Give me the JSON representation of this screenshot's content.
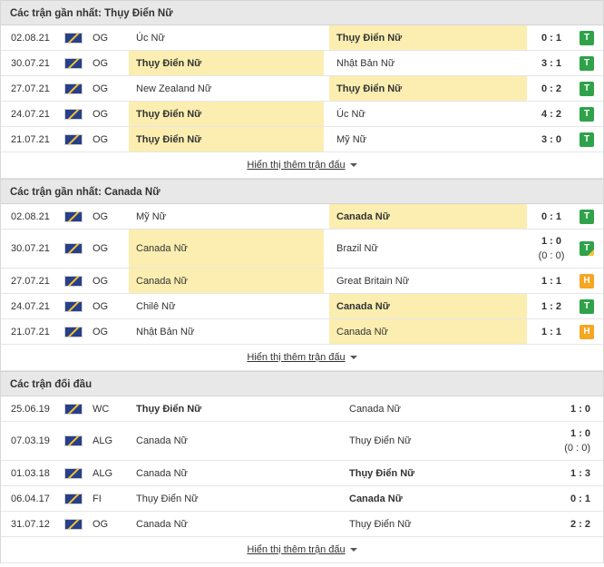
{
  "sections": [
    {
      "title": "Các trận gần nhất: Thụy Điển Nữ",
      "more_label": "Hiển thị thêm trận đấu",
      "matches": [
        {
          "date": "02.08.21",
          "comp": "OG",
          "home": "Úc Nữ",
          "away": "Thụy Điển Nữ",
          "highlight": "away",
          "score": "0 : 1",
          "sub": "",
          "result": "T",
          "result_color": "#2fa24a"
        },
        {
          "date": "30.07.21",
          "comp": "OG",
          "home": "Thụy Điển Nữ",
          "away": "Nhật Bản Nữ",
          "highlight": "home",
          "score": "3 : 1",
          "sub": "",
          "result": "T",
          "result_color": "#2fa24a"
        },
        {
          "date": "27.07.21",
          "comp": "OG",
          "home": "New Zealand Nữ",
          "away": "Thụy Điển Nữ",
          "highlight": "away",
          "score": "0 : 2",
          "sub": "",
          "result": "T",
          "result_color": "#2fa24a"
        },
        {
          "date": "24.07.21",
          "comp": "OG",
          "home": "Thụy Điển Nữ",
          "away": "Úc Nữ",
          "highlight": "home",
          "score": "4 : 2",
          "sub": "",
          "result": "T",
          "result_color": "#2fa24a"
        },
        {
          "date": "21.07.21",
          "comp": "OG",
          "home": "Thụy Điển Nữ",
          "away": "Mỹ Nữ",
          "highlight": "home",
          "score": "3 : 0",
          "sub": "",
          "result": "T",
          "result_color": "#2fa24a"
        }
      ]
    },
    {
      "title": "Các trận gần nhất: Canada Nữ",
      "more_label": "Hiển thị thêm trận đấu",
      "matches": [
        {
          "date": "02.08.21",
          "comp": "OG",
          "home": "Mỹ Nữ",
          "away": "Canada Nữ",
          "highlight": "away",
          "score": "0 : 1",
          "sub": "",
          "result": "T",
          "result_color": "#2fa24a"
        },
        {
          "date": "30.07.21",
          "comp": "OG",
          "home": "Canada Nữ",
          "away": "Brazil Nữ",
          "highlight": "home-light",
          "score": "1 : 0",
          "sub": "(0 : 0)",
          "result": "T",
          "result_color": "#2fa24a",
          "corner": true
        },
        {
          "date": "27.07.21",
          "comp": "OG",
          "home": "Canada Nữ",
          "away": "Great Britain Nữ",
          "highlight": "home-light",
          "score": "1 : 1",
          "sub": "",
          "result": "H",
          "result_color": "#f5a623"
        },
        {
          "date": "24.07.21",
          "comp": "OG",
          "home": "Chilê Nữ",
          "away": "Canada Nữ",
          "highlight": "away",
          "score": "1 : 2",
          "sub": "",
          "result": "T",
          "result_color": "#2fa24a"
        },
        {
          "date": "21.07.21",
          "comp": "OG",
          "home": "Nhật Bản Nữ",
          "away": "Canada Nữ",
          "highlight": "away-light",
          "score": "1 : 1",
          "sub": "",
          "result": "H",
          "result_color": "#f5a623"
        }
      ]
    }
  ],
  "h2h": {
    "title": "Các trận đối đầu",
    "more_label": "Hiển thị thêm trận đấu",
    "matches": [
      {
        "date": "25.06.19",
        "comp": "WC",
        "home": "Thụy Điển Nữ",
        "away": "Canada Nữ",
        "bold": "home",
        "score": "1 : 0",
        "sub": ""
      },
      {
        "date": "07.03.19",
        "comp": "ALG",
        "home": "Canada Nữ",
        "away": "Thụy Điển Nữ",
        "bold": "",
        "score": "1 : 0",
        "sub": "(0 : 0)"
      },
      {
        "date": "01.03.18",
        "comp": "ALG",
        "home": "Canada Nữ",
        "away": "Thụy Điển Nữ",
        "bold": "away",
        "score": "1 : 3",
        "sub": ""
      },
      {
        "date": "06.04.17",
        "comp": "FI",
        "home": "Thụy Điển Nữ",
        "away": "Canada Nữ",
        "bold": "away",
        "score": "0 : 1",
        "sub": ""
      },
      {
        "date": "31.07.12",
        "comp": "OG",
        "home": "Canada Nữ",
        "away": "Thụy Điển Nữ",
        "bold": "",
        "score": "2 : 2",
        "sub": ""
      }
    ]
  },
  "icons": {
    "flag": "world-flag-icon",
    "caret": "caret-down-icon"
  }
}
